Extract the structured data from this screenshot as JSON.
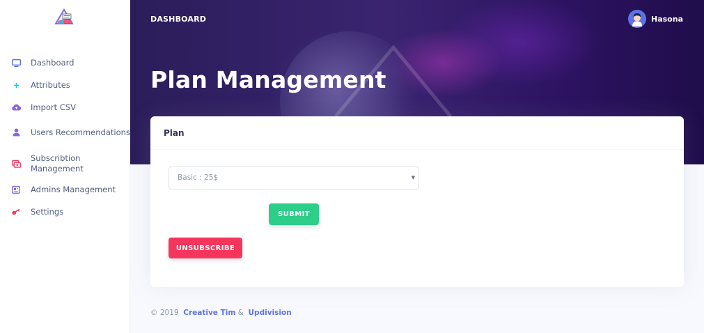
{
  "sidebar": {
    "logo_icon": "creative-tim-logo",
    "items": [
      {
        "label": "Dashboard",
        "icon": "tv-icon",
        "color": "#5e72e4"
      },
      {
        "label": "Attributes",
        "icon": "plus-icon",
        "color": "#11cdef"
      },
      {
        "label": "Import CSV",
        "icon": "cloud-upload-icon",
        "color": "#8965e0"
      },
      {
        "label": "Users Recommendations",
        "icon": "user-icon",
        "color": "#8965e0"
      },
      {
        "label": "Subscribtion Management",
        "icon": "money-icon",
        "color": "#f5365c"
      },
      {
        "label": "Admins Management",
        "icon": "id-card-icon",
        "color": "#8965e0"
      },
      {
        "label": "Settings",
        "icon": "key-icon",
        "color": "#f5365c"
      }
    ]
  },
  "header": {
    "breadcrumb": "DASHBOARD",
    "user_name": "Hasona",
    "title": "Plan Management"
  },
  "card": {
    "title": "Plan",
    "plan_select": {
      "value": "Basic : 25$"
    },
    "submit_label": "SUBMIT",
    "unsubscribe_label": "UNSUBSCRIBE"
  },
  "footer": {
    "copyright": "© 2019",
    "link1": "Creative Tim",
    "separator": "&",
    "link2": "Updivision"
  },
  "colors": {
    "primary": "#5e72e4",
    "success": "#2dce89",
    "danger": "#f5365c",
    "header_bg": "#2b1d5a"
  }
}
